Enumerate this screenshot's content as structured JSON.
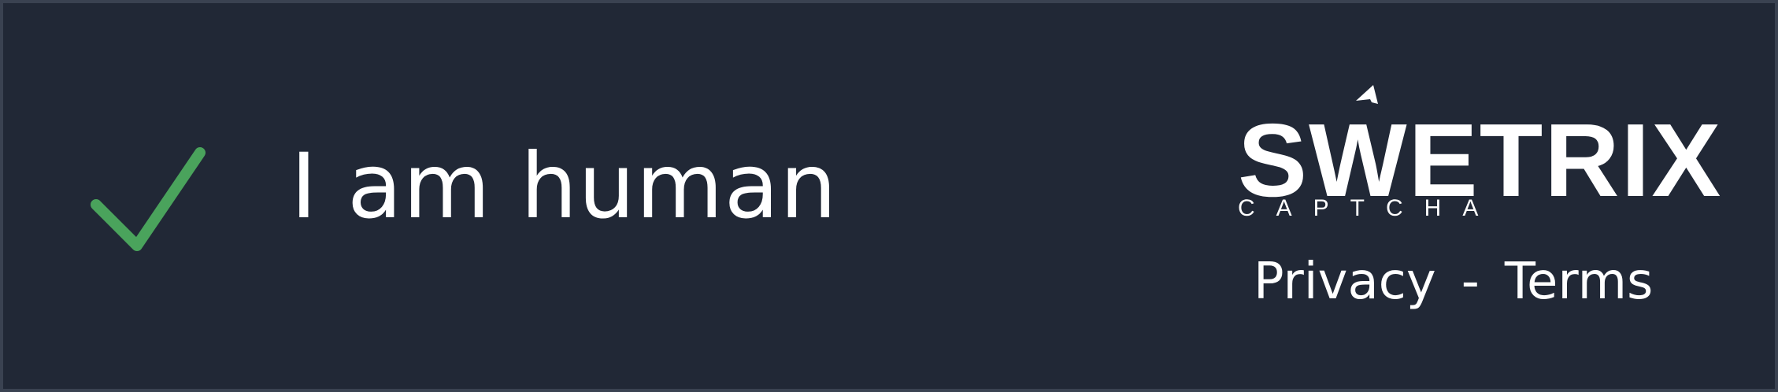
{
  "captcha": {
    "status_label": "I am human",
    "check_icon": "checkmark-icon",
    "check_color": "#4aa35c",
    "brand": {
      "name": "SWETRIX",
      "subtitle": "CAPTCHA"
    },
    "links": {
      "privacy": "Privacy",
      "separator": "-",
      "terms": "Terms"
    },
    "colors": {
      "background": "#212836",
      "border": "#3a4251",
      "text": "#ffffff"
    }
  }
}
